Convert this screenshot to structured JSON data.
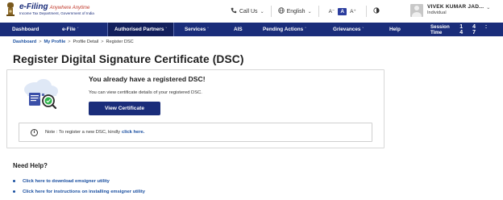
{
  "header": {
    "brand_main": "e-Filing",
    "brand_tagline": "Anywhere Anytime",
    "brand_sub": "Income Tax Department, Government of India",
    "call_us": "Call Us",
    "language": "English",
    "font_small": "A⁻",
    "font_normal": "A",
    "font_large": "A⁺",
    "user_name": "VIVEK KUMAR JAD...",
    "user_role": "Individual"
  },
  "nav": {
    "items": [
      {
        "label": "Dashboard",
        "dropdown": false
      },
      {
        "label": "e-File",
        "dropdown": true
      },
      {
        "label": "Authorised Partners",
        "dropdown": true
      },
      {
        "label": "Services",
        "dropdown": true
      },
      {
        "label": "AIS",
        "dropdown": false
      },
      {
        "label": "Pending Actions",
        "dropdown": true
      },
      {
        "label": "Grievances",
        "dropdown": true
      },
      {
        "label": "Help",
        "dropdown": false
      }
    ],
    "session_label": "Session Time",
    "session_digits": "1 4 : 4 7"
  },
  "breadcrumb": {
    "items": [
      "Dashboard",
      "My Profile",
      "Profile Detail",
      "Register DSC"
    ],
    "separator": ">"
  },
  "page_title": "Register Digital Signature Certificate (DSC)",
  "card": {
    "heading": "You already have a registered DSC!",
    "description": "You can view certificate details of your registered DSC.",
    "button_label": "View Certificate",
    "note_prefix": "Note : To register a new DSC, kindly",
    "note_link": "click here."
  },
  "help": {
    "title": "Need Help?",
    "links": [
      "Click here to download emsigner utility",
      "Click here for instructions on installing emsigner utility"
    ]
  },
  "colors": {
    "nav_bg": "#1a2d7a",
    "link": "#1a4fa0",
    "brand_red": "#c0392b"
  }
}
